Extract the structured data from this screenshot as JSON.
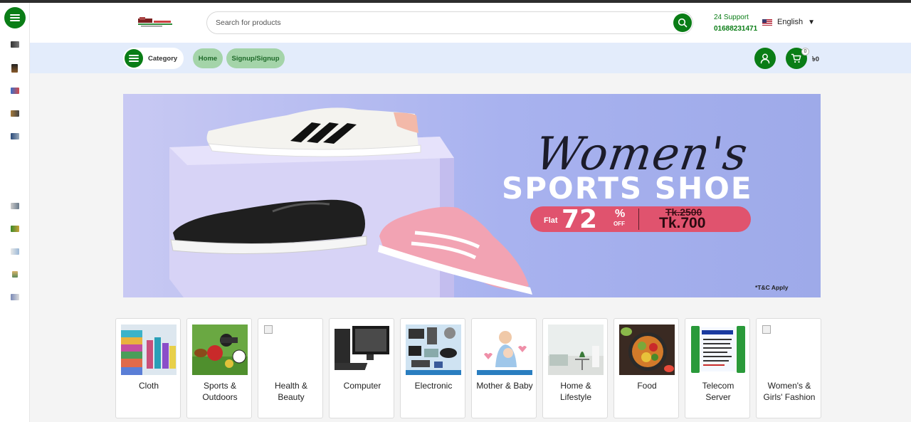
{
  "header": {
    "search_placeholder": "Search for products",
    "support_label": "24 Support",
    "support_number": "01688231471",
    "language": "English",
    "language_arrow": "▼"
  },
  "nav": {
    "category_label": "Category",
    "home_label": "Home",
    "signup_label": "Signup/Signup",
    "cart_count": "0",
    "cart_total": "৳0"
  },
  "banner": {
    "script_text": "Women's",
    "title": "SPORTS SHOE",
    "flat_label": "Flat",
    "discount": "72",
    "percent_sign": "%",
    "off_label": "OFF",
    "old_price": "Tk.2500",
    "new_price": "Tk.700",
    "terms": "*T&C Apply"
  },
  "categories": [
    {
      "line1": "Cloth",
      "line2": ""
    },
    {
      "line1": "Sports &",
      "line2": "Outdoors"
    },
    {
      "line1": "Health &",
      "line2": "Beauty"
    },
    {
      "line1": "Computer",
      "line2": ""
    },
    {
      "line1": "Electronic",
      "line2": ""
    },
    {
      "line1": "Mother & Baby",
      "line2": ""
    },
    {
      "line1": "Home &",
      "line2": "Lifestyle"
    },
    {
      "line1": "Food",
      "line2": ""
    },
    {
      "line1": "Telecom",
      "line2": "Server"
    },
    {
      "line1": "Women's &",
      "line2": "Girls' Fashion"
    }
  ],
  "colors": {
    "brand_green": "#0a7d16",
    "nav_bg": "#e3ecfb",
    "pill_green": "#a4d4a9",
    "offer_pink": "#e0536e"
  }
}
